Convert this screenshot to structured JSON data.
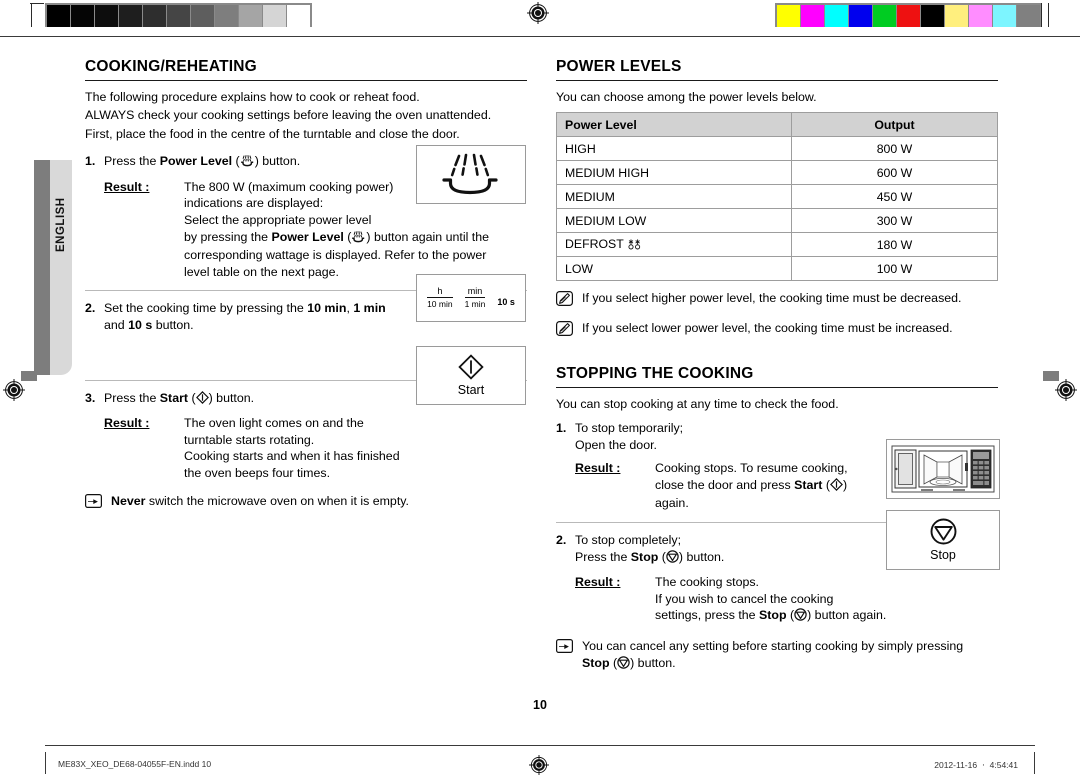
{
  "print_marks": {
    "gray_strip_label": "grayscale-calibration-strip",
    "gray_swatches": [
      "#000000",
      "#050505",
      "#0d0d0d",
      "#1e1e1e",
      "#2e2e2e",
      "#454545",
      "#5e5e5e",
      "#7e7e7e",
      "#a5a5a5",
      "#d5d5d5",
      "#ffffff"
    ],
    "color_strip_label": "color-calibration-strip",
    "color_swatches": [
      "#ffff00",
      "#ff00ff",
      "#00ffff",
      "#0000ee",
      "#00cc22",
      "#ee1111",
      "#000000",
      "#ffef7e",
      "#ff8dff",
      "#7df5ff",
      "#808080"
    ]
  },
  "language_tab": {
    "label": "ENGLISH"
  },
  "left_column": {
    "title": "COOKING/REHEATING",
    "intro": [
      "The following procedure explains how to cook or reheat food.",
      "ALWAYS check your cooking settings before leaving the oven unattended.",
      "First, place the food in the centre of the turntable and close the door."
    ],
    "steps": [
      {
        "num": "1.",
        "text_before": "Press the ",
        "bold": "Power Level",
        "text_after": " (",
        "icon": "power-level-icon",
        "text_end": ") button.",
        "result_label": "Result :",
        "result_lines": [
          "The 800 W (maximum cooking power)",
          "indications are displayed:",
          "Select the appropriate power level"
        ],
        "result_rich_before": "by pressing the ",
        "result_rich_bold": "Power Level",
        "result_rich_mid": " (",
        "result_rich_icon": "power-level-icon",
        "result_rich_after": ") button again until the",
        "result_tail": [
          "corresponding wattage is displayed. Refer to the power",
          "level table on the next page."
        ],
        "illustration": "dish-with-microwave-rays"
      },
      {
        "num": "2.",
        "line1_before": "Set the cooking time by pressing the ",
        "line1_b1": "10 min",
        "line1_sep": ", ",
        "line1_b2": "1 min",
        "line2_before": "and ",
        "line2_b3": "10 s",
        "line2_after": " button.",
        "illustration": "timer-buttons-diagram",
        "illus_fraction1_top": "h",
        "illus_fraction1_bottom": "10 min",
        "illus_fraction2_top": "min",
        "illus_fraction2_bottom": "1 min",
        "illus_third": "10 s"
      },
      {
        "num": "3.",
        "text_before": "Press the ",
        "bold": "Start",
        "text_after": " (",
        "icon": "start-icon",
        "text_end": ") button.",
        "result_label": "Result :",
        "result_lines": [
          "The oven light comes on and the",
          "turntable starts rotating.",
          "Cooking starts and when it has finished",
          "the oven beeps four times."
        ],
        "illustration": "start-button",
        "illus_caption": "Start"
      }
    ],
    "warning": {
      "icon": "pointing-hand-icon",
      "bold": "Never",
      "text": " switch the microwave oven on when it is empty."
    }
  },
  "right_column": {
    "power_levels": {
      "title": "POWER LEVELS",
      "intro": "You can choose among the power levels below.",
      "table": {
        "headers": [
          "Power Level",
          "Output"
        ],
        "rows": [
          {
            "level": "HIGH",
            "level_icon": "",
            "output": "800 W"
          },
          {
            "level": "MEDIUM HIGH",
            "level_icon": "",
            "output": "600 W"
          },
          {
            "level": "MEDIUM",
            "level_icon": "",
            "output": "450 W"
          },
          {
            "level": "MEDIUM LOW",
            "level_icon": "",
            "output": "300 W"
          },
          {
            "level": "DEFROST",
            "level_icon": "defrost-icon",
            "output": "180 W"
          },
          {
            "level": "LOW",
            "level_icon": "",
            "output": "100 W"
          }
        ]
      },
      "notes": [
        {
          "icon": "note-pencil-icon",
          "text": "If you select higher power level, the cooking time must be decreased."
        },
        {
          "icon": "note-pencil-icon",
          "text": "If you select lower power level, the cooking time must be increased."
        }
      ]
    },
    "stopping": {
      "title": "STOPPING THE COOKING",
      "intro": "You can stop cooking at any time to check the food.",
      "steps": [
        {
          "num": "1.",
          "line1": "To stop temporarily;",
          "line2": "Open the door.",
          "result_label": "Result :",
          "res_l1": "Cooking stops. To resume cooking,",
          "res_l2_before": "close the door and press ",
          "res_l2_bold": "Start",
          "res_l2_mid": " (",
          "res_l2_icon": "start-icon",
          "res_l2_after": ")",
          "res_l3": "again.",
          "illustration": "microwave-oven-open-door"
        },
        {
          "num": "2.",
          "line1": "To stop completely;",
          "line2_before": "Press the ",
          "line2_bold": "Stop",
          "line2_mid": " (",
          "line2_icon": "stop-icon",
          "line2_after": ") button.",
          "result_label": "Result :",
          "res_l1": "The cooking stops.",
          "res_l2": "If you wish to cancel the cooking",
          "res_l3_before": "settings, press the ",
          "res_l3_bold": "Stop",
          "res_l3_mid": " (",
          "res_l3_icon": "stop-icon",
          "res_l3_after": ") button again.",
          "illustration": "stop-button",
          "illus_caption": "Stop"
        }
      ],
      "note": {
        "icon": "pointing-hand-icon",
        "line1": "You can cancel any setting before starting cooking by simply pressing",
        "line2_bold": "Stop",
        "line2_mid": " (",
        "line2_icon": "stop-icon",
        "line2_after": ") button."
      }
    }
  },
  "page_number": "10",
  "footer": {
    "file": "ME83X_XEO_DE68-04055F-EN.indd   10",
    "date": "2012-11-16   ㆍ 4:54:41"
  }
}
